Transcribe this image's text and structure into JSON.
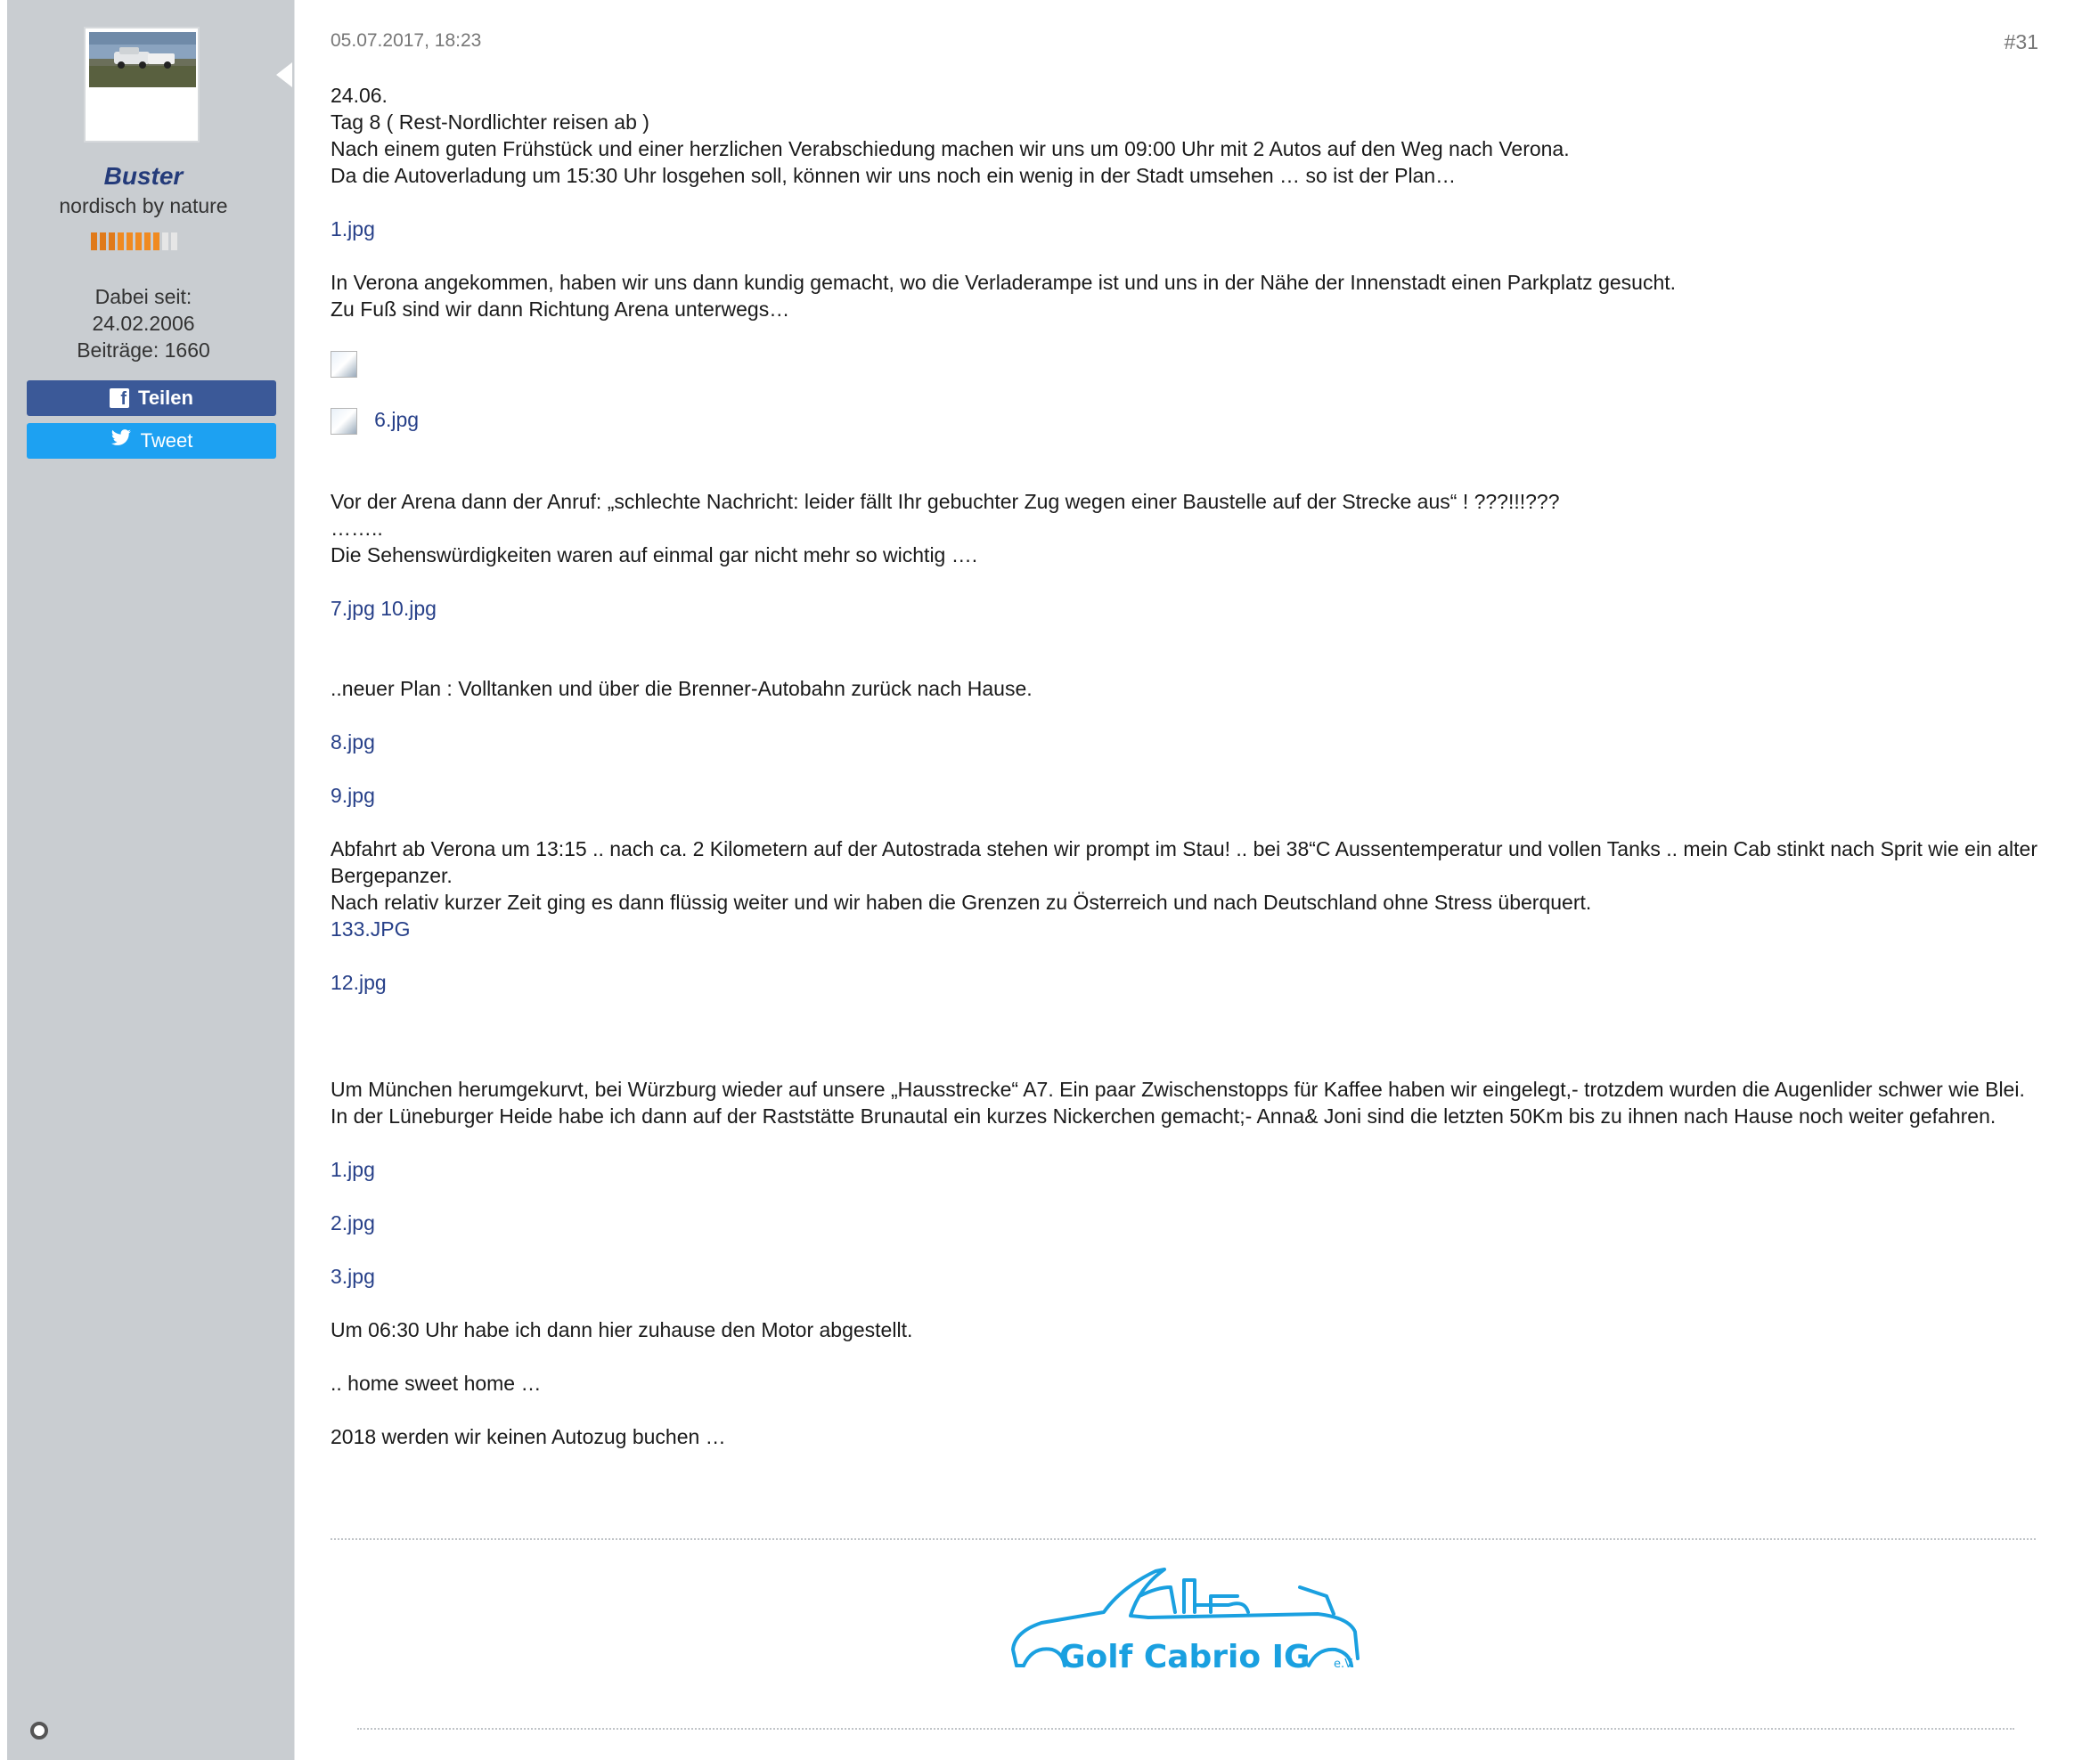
{
  "user": {
    "name": "Buster",
    "title": "nordisch by nature",
    "member_since_label": "Dabei seit:",
    "member_since": "24.02.2006",
    "posts_label": "Beiträge: 1660",
    "rank_filled": 8,
    "rank_total": 10
  },
  "share": {
    "facebook_label": "Teilen",
    "twitter_label": "Tweet"
  },
  "post": {
    "date": "05.07.2017, 18:23",
    "number": "#31"
  },
  "message": {
    "l01": "24.06.",
    "l02": "Tag 8 ( Rest-Nordlichter reisen ab )",
    "l03": "Nach einem guten Frühstück und einer herzlichen Verabschiedung machen wir uns um 09:00 Uhr mit 2 Autos auf den Weg nach Verona.",
    "l04": "Da die Autoverladung um 15:30 Uhr losgehen soll, können wir uns noch ein wenig in der Stadt umsehen … so ist der Plan…",
    "a01": "1.jpg",
    "l05": "In Verona angekommen, haben wir uns dann kundig gemacht, wo die Verladerampe ist und uns in der Nähe der Innenstadt einen Parkplatz gesucht.",
    "l06": "Zu Fuß sind wir dann Richtung Arena unterwegs…",
    "a02": "6.jpg",
    "l07": "Vor der Arena dann der Anruf: „schlechte Nachricht: leider fällt Ihr gebuchter Zug wegen einer Baustelle auf der Strecke aus“ ! ???!!!???",
    "l08": "……..",
    "l09": "Die Sehenswürdigkeiten waren auf einmal gar nicht mehr so wichtig ….",
    "a03": "7.jpg",
    "a04": "10.jpg",
    "l10": "..neuer Plan : Volltanken und über die Brenner-Autobahn zurück nach Hause.",
    "a05": "8.jpg",
    "a06": "9.jpg",
    "l11": "Abfahrt ab Verona um 13:15 .. nach ca. 2 Kilometern auf der Autostrada stehen wir prompt im Stau! .. bei 38“C Aussentemperatur und vollen Tanks .. mein Cab stinkt nach Sprit wie ein alter Bergepanzer.",
    "l12": "Nach relativ kurzer Zeit ging es dann flüssig weiter und wir haben die Grenzen zu Österreich und nach Deutschland ohne Stress überquert.",
    "a07": "133.JPG",
    "a08": "12.jpg",
    "l13": "Um München herumgekurvt, bei Würzburg wieder auf unsere „Hausstrecke“ A7. Ein paar Zwischenstopps für Kaffee haben wir eingelegt,- trotzdem wurden die Augenlider schwer wie Blei.",
    "l14": "In der Lüneburger Heide habe ich dann auf der Raststätte Brunautal ein kurzes Nickerchen gemacht;- Anna& Joni sind die letzten 50Km bis zu ihnen nach Hause noch weiter gefahren.",
    "a09": "1.jpg",
    "a10": "2.jpg",
    "a11": "3.jpg",
    "l15": "Um 06:30 Uhr habe ich dann hier zuhause den Motor abgestellt.",
    "l16": ".. home sweet home …",
    "l17": "2018 werden wir keinen Autozug buchen …"
  },
  "signature": {
    "logo_text": "Golf Cabrio IG",
    "logo_suffix": "e.V.",
    "logo_color": "#1aa0e0"
  },
  "colors": {
    "sidebar_bg": "#c9cdd1",
    "link": "#274089",
    "username": "#243b7a",
    "facebook": "#3b5998",
    "twitter": "#1da1f2"
  }
}
